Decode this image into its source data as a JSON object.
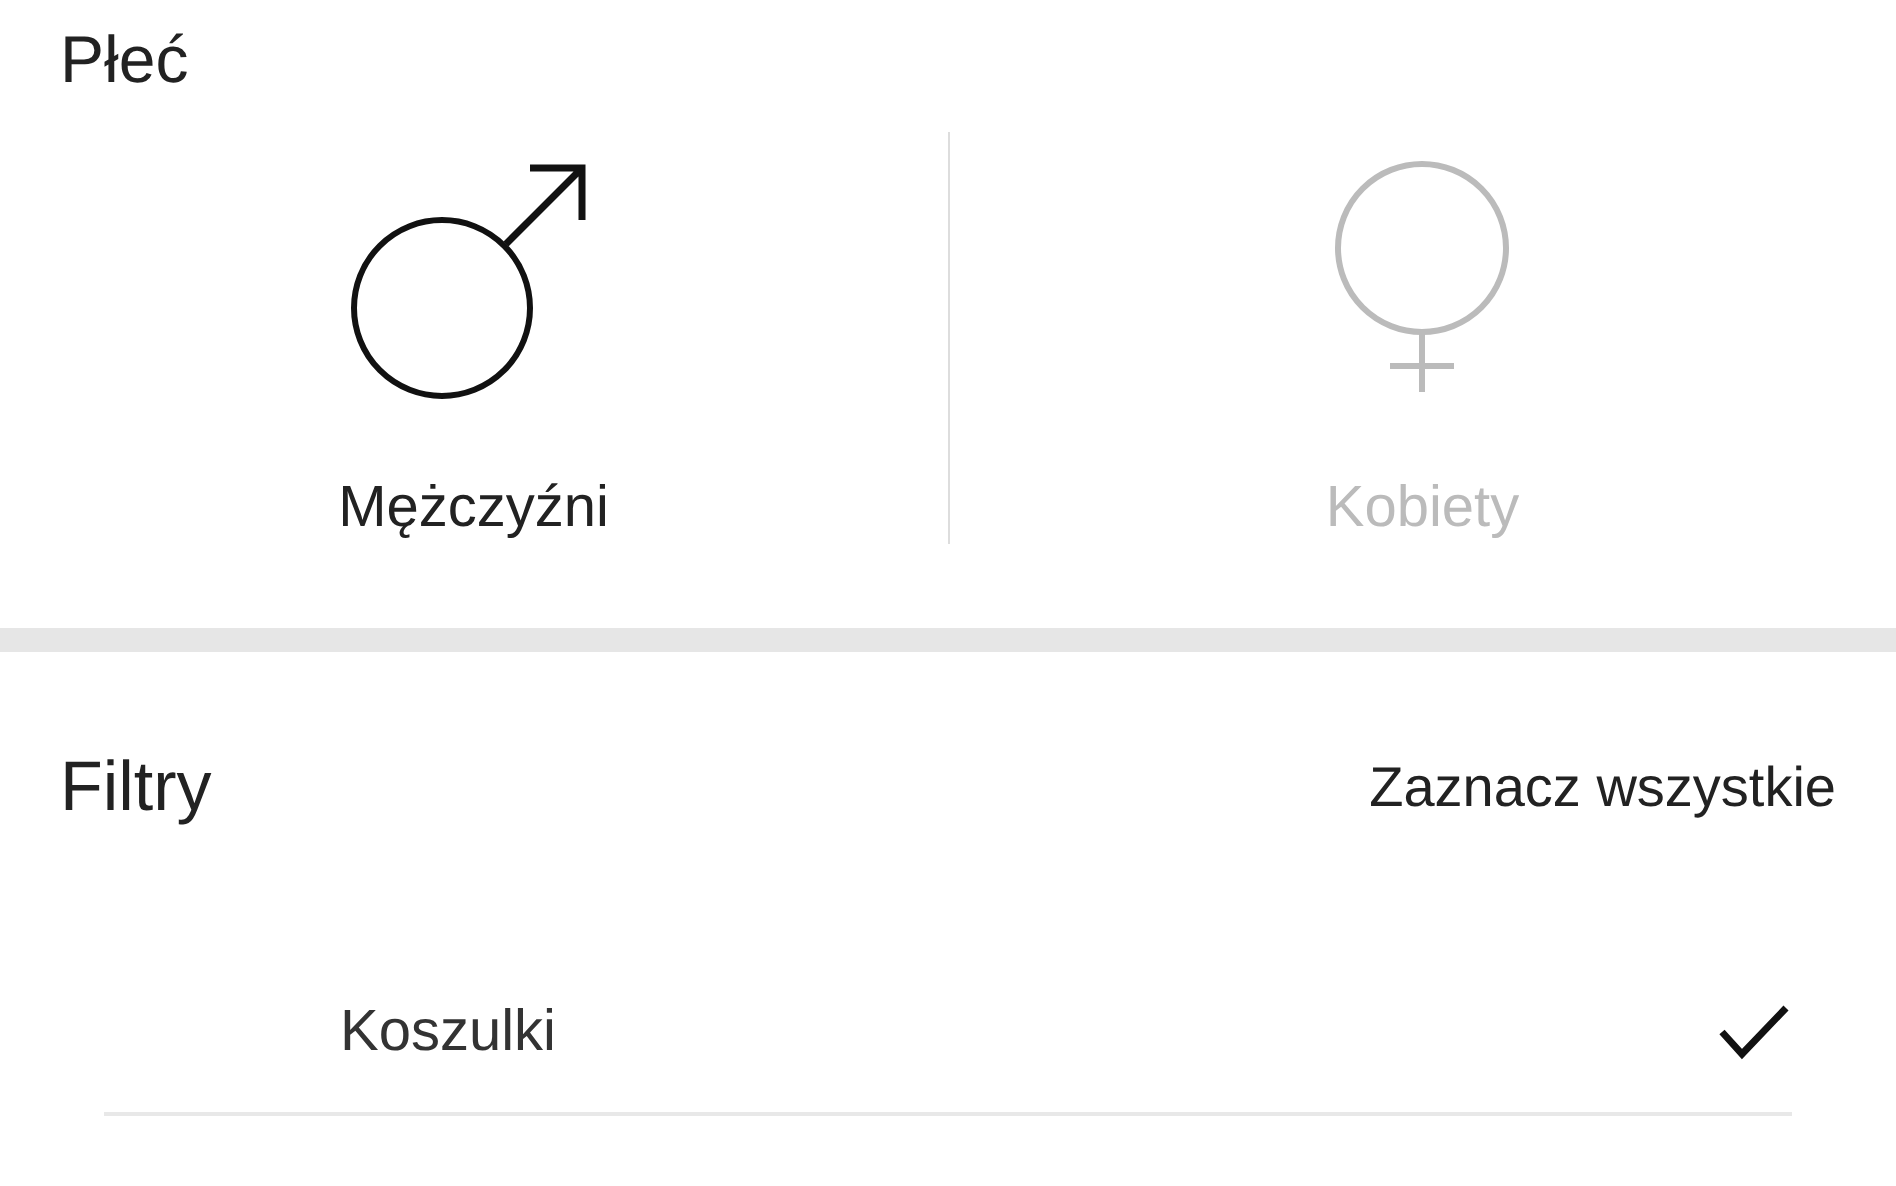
{
  "gender_section": {
    "title": "Płeć",
    "options": [
      {
        "kind": "male",
        "label": "Mężczyźni",
        "selected": true
      },
      {
        "kind": "female",
        "label": "Kobiety",
        "selected": false
      }
    ]
  },
  "filters": {
    "title": "Filtry",
    "select_all": "Zaznacz wszystkie",
    "items": [
      {
        "label": "Koszulki",
        "checked": true
      }
    ]
  }
}
